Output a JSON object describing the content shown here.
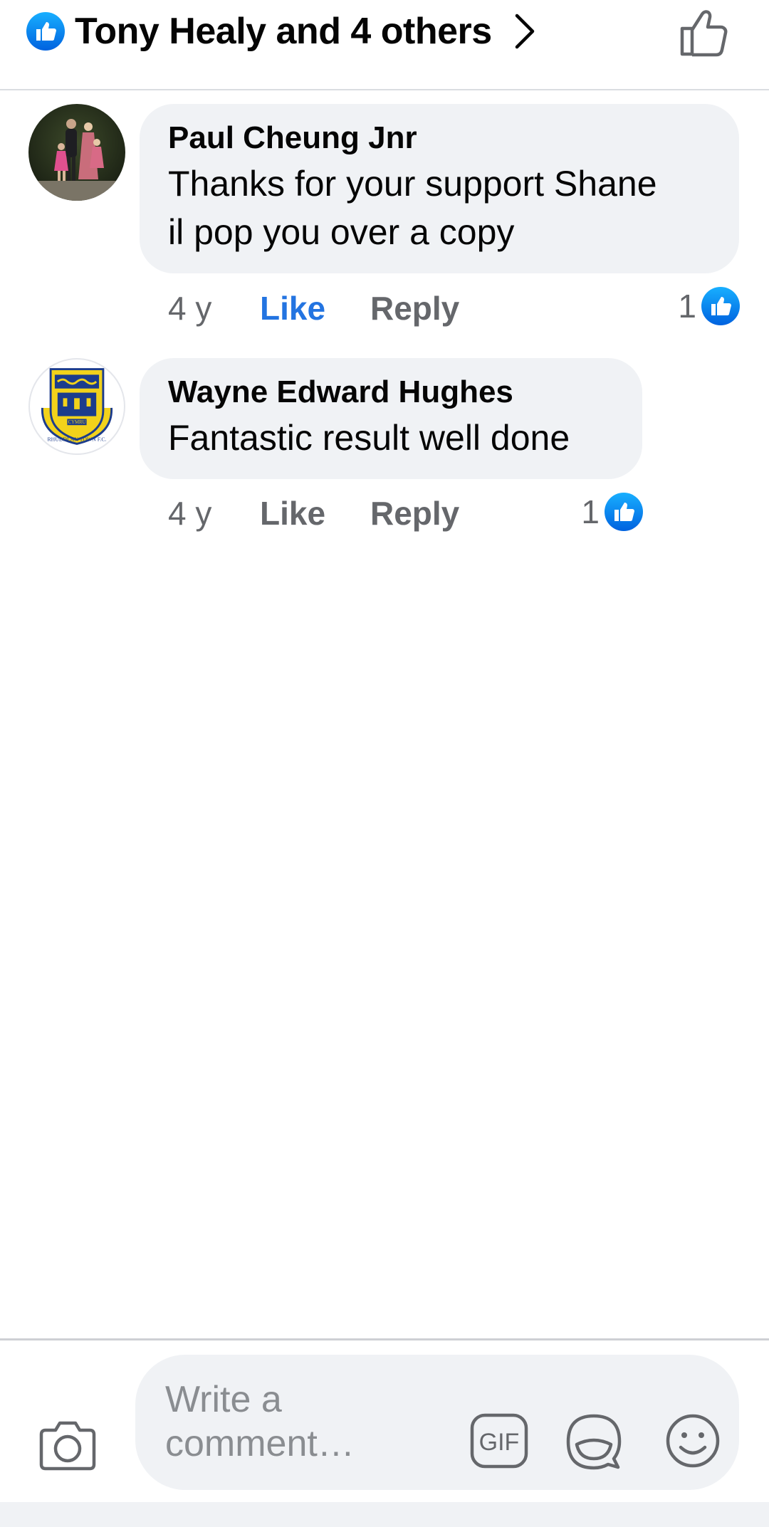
{
  "header": {
    "title": "Tony Healy and 4 others"
  },
  "comments": [
    {
      "author": "Paul Cheung Jnr",
      "text_lines": [
        "Thanks for your support Shane",
        "il pop you over a copy"
      ],
      "time": "4 y",
      "like_label": "Like",
      "like_active": true,
      "reply_label": "Reply",
      "reaction_count": "1",
      "reaction_icon": "like-reaction-icon"
    },
    {
      "author": "Wayne Edward Hughes",
      "text_lines": [
        "Fantastic result well done"
      ],
      "time": "4 y",
      "like_label": "Like",
      "like_active": false,
      "reply_label": "Reply",
      "reaction_count": "1",
      "reaction_icon": "like-reaction-icon",
      "avatar_logo_text": [
        "CYMRU",
        "RHUDDLAN TOWN F.C."
      ]
    }
  ],
  "composer": {
    "placeholder_lines": [
      "Write a",
      "comment…"
    ],
    "gif_label": "GIF"
  },
  "colors": {
    "accent_blue": "#2374e1",
    "bubble_bg": "#f0f2f5",
    "secondary_text": "#65676b",
    "placeholder_text": "#8a8d91"
  }
}
